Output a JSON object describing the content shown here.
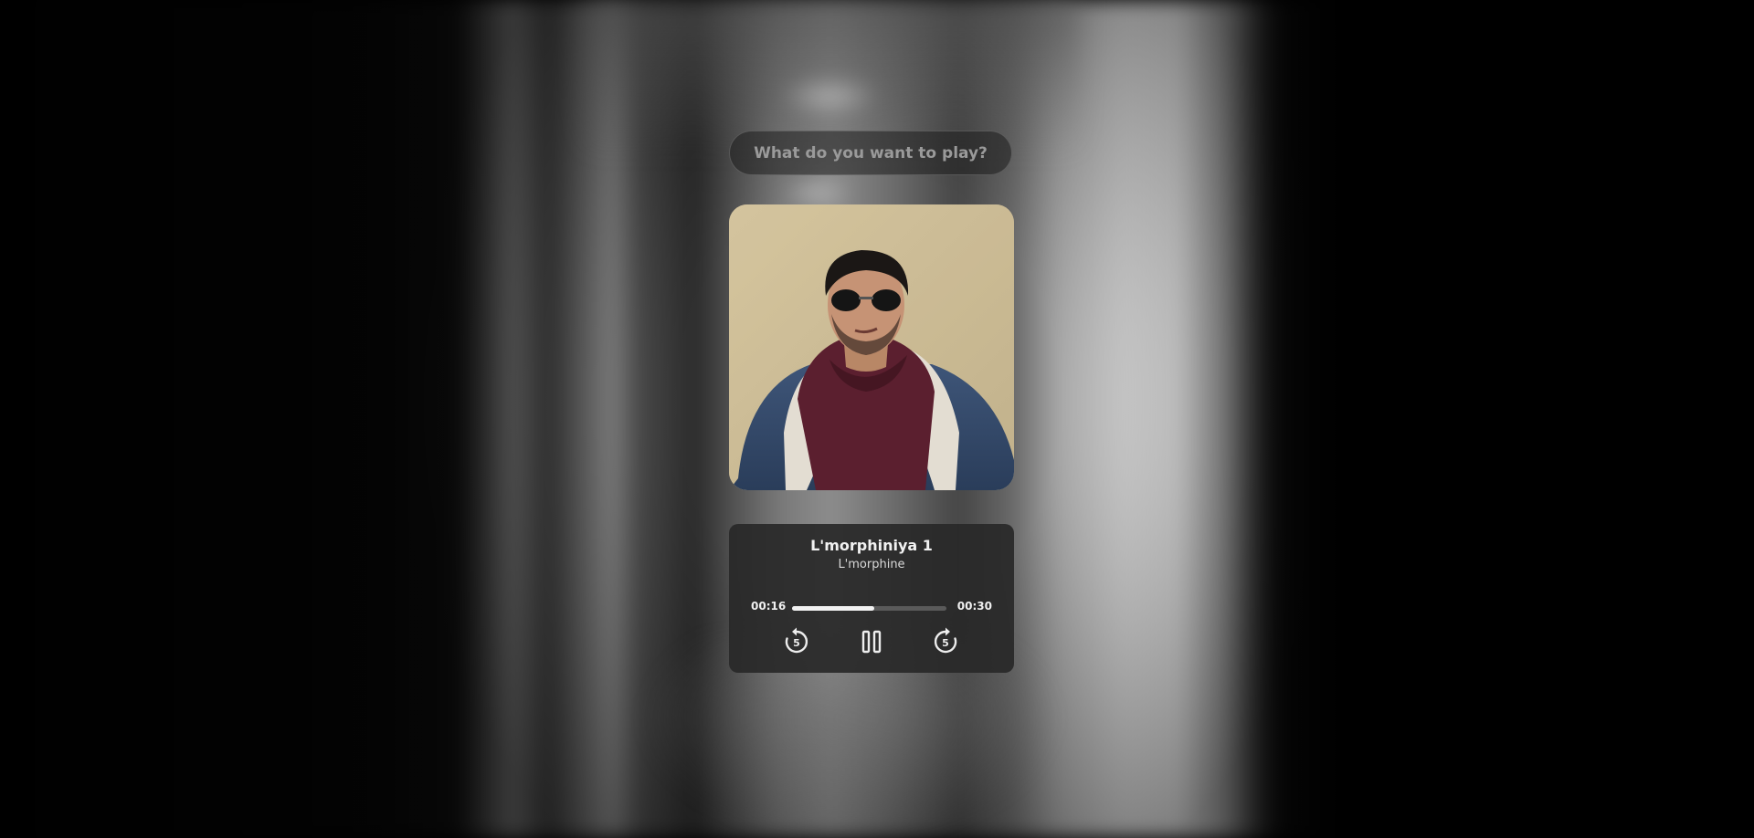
{
  "search": {
    "placeholder": "What do you want to play?"
  },
  "now_playing": {
    "title": "L'morphiniya 1",
    "artist": "L'morphine",
    "elapsed": "00:16",
    "duration": "00:30",
    "progress_fraction": 0.533
  },
  "controls": {
    "rewind_icon": "rewind-5-icon",
    "pause_icon": "pause-icon",
    "forward_icon": "forward-5-icon",
    "skip_seconds_label": "5"
  },
  "colors": {
    "card_background": "#282828",
    "progress_track": "#5a5a5a",
    "progress_fill": "#f2f2f2",
    "text_primary": "#f2f2f2"
  }
}
